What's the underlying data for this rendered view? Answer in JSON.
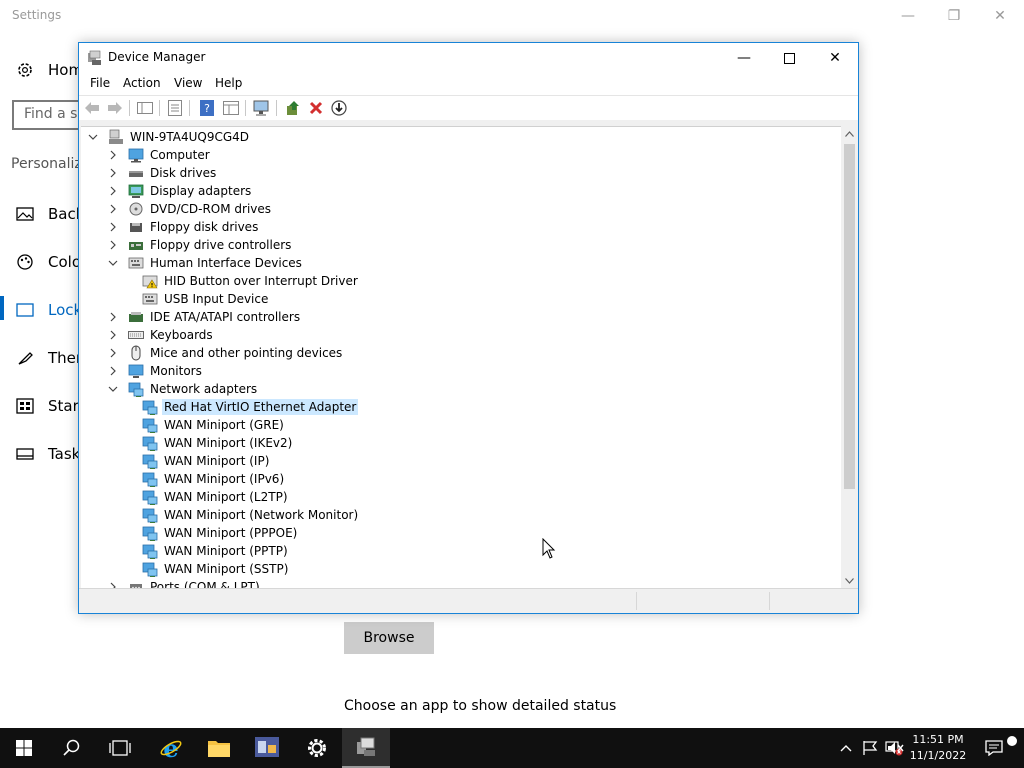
{
  "settings": {
    "title": "Settings",
    "home_label": "Home",
    "search_placeholder": "Find a se",
    "section": "Personaliz",
    "nav": [
      {
        "label": "Back",
        "icon": "background-icon"
      },
      {
        "label": "Colo",
        "icon": "colors-icon"
      },
      {
        "label": "Lock",
        "icon": "lock-screen-icon"
      },
      {
        "label": "Ther",
        "icon": "themes-icon"
      },
      {
        "label": "Start",
        "icon": "start-icon"
      },
      {
        "label": "Taskl",
        "icon": "taskbar-icon"
      }
    ],
    "browse_label": "Browse",
    "choose_text": "Choose an app to show detailed status"
  },
  "device_manager": {
    "title": "Device Manager",
    "menu": [
      "File",
      "Action",
      "View",
      "Help"
    ],
    "root": "WIN-9TA4UQ9CG4D",
    "tree": [
      {
        "label": "Computer",
        "level": 1,
        "expanded": false,
        "icon": "computer-icon"
      },
      {
        "label": "Disk drives",
        "level": 1,
        "expanded": false,
        "icon": "disk-drive-icon"
      },
      {
        "label": "Display adapters",
        "level": 1,
        "expanded": false,
        "icon": "display-adapter-icon"
      },
      {
        "label": "DVD/CD-ROM drives",
        "level": 1,
        "expanded": false,
        "icon": "dvd-drive-icon"
      },
      {
        "label": "Floppy disk drives",
        "level": 1,
        "expanded": false,
        "icon": "floppy-icon"
      },
      {
        "label": "Floppy drive controllers",
        "level": 1,
        "expanded": false,
        "icon": "controller-icon"
      },
      {
        "label": "Human Interface Devices",
        "level": 1,
        "expanded": true,
        "icon": "hid-icon"
      },
      {
        "label": "HID Button over Interrupt Driver",
        "level": 2,
        "icon": "hid-warning-icon"
      },
      {
        "label": "USB Input Device",
        "level": 2,
        "icon": "hid-icon"
      },
      {
        "label": "IDE ATA/ATAPI controllers",
        "level": 1,
        "expanded": false,
        "icon": "ide-controller-icon"
      },
      {
        "label": "Keyboards",
        "level": 1,
        "expanded": false,
        "icon": "keyboard-icon"
      },
      {
        "label": "Mice and other pointing devices",
        "level": 1,
        "expanded": false,
        "icon": "mouse-icon"
      },
      {
        "label": "Monitors",
        "level": 1,
        "expanded": false,
        "icon": "monitor-icon"
      },
      {
        "label": "Network adapters",
        "level": 1,
        "expanded": true,
        "icon": "network-adapter-icon"
      },
      {
        "label": "Red Hat VirtIO Ethernet Adapter",
        "level": 2,
        "selected": true,
        "icon": "network-adapter-icon"
      },
      {
        "label": "WAN Miniport (GRE)",
        "level": 2,
        "icon": "network-adapter-icon"
      },
      {
        "label": "WAN Miniport (IKEv2)",
        "level": 2,
        "icon": "network-adapter-icon"
      },
      {
        "label": "WAN Miniport (IP)",
        "level": 2,
        "icon": "network-adapter-icon"
      },
      {
        "label": "WAN Miniport (IPv6)",
        "level": 2,
        "icon": "network-adapter-icon"
      },
      {
        "label": "WAN Miniport (L2TP)",
        "level": 2,
        "icon": "network-adapter-icon"
      },
      {
        "label": "WAN Miniport (Network Monitor)",
        "level": 2,
        "icon": "network-adapter-icon"
      },
      {
        "label": "WAN Miniport (PPPOE)",
        "level": 2,
        "icon": "network-adapter-icon"
      },
      {
        "label": "WAN Miniport (PPTP)",
        "level": 2,
        "icon": "network-adapter-icon"
      },
      {
        "label": "WAN Miniport (SSTP)",
        "level": 2,
        "icon": "network-adapter-icon"
      },
      {
        "label": "Ports (COM & LPT)",
        "level": 1,
        "expanded": false,
        "icon": "port-icon"
      }
    ]
  },
  "taskbar": {
    "time": "11:51 PM",
    "date": "11/1/2022"
  },
  "colors": {
    "selection": "#cce8ff",
    "accent": "#0067c0",
    "taskbar": "#101010"
  }
}
